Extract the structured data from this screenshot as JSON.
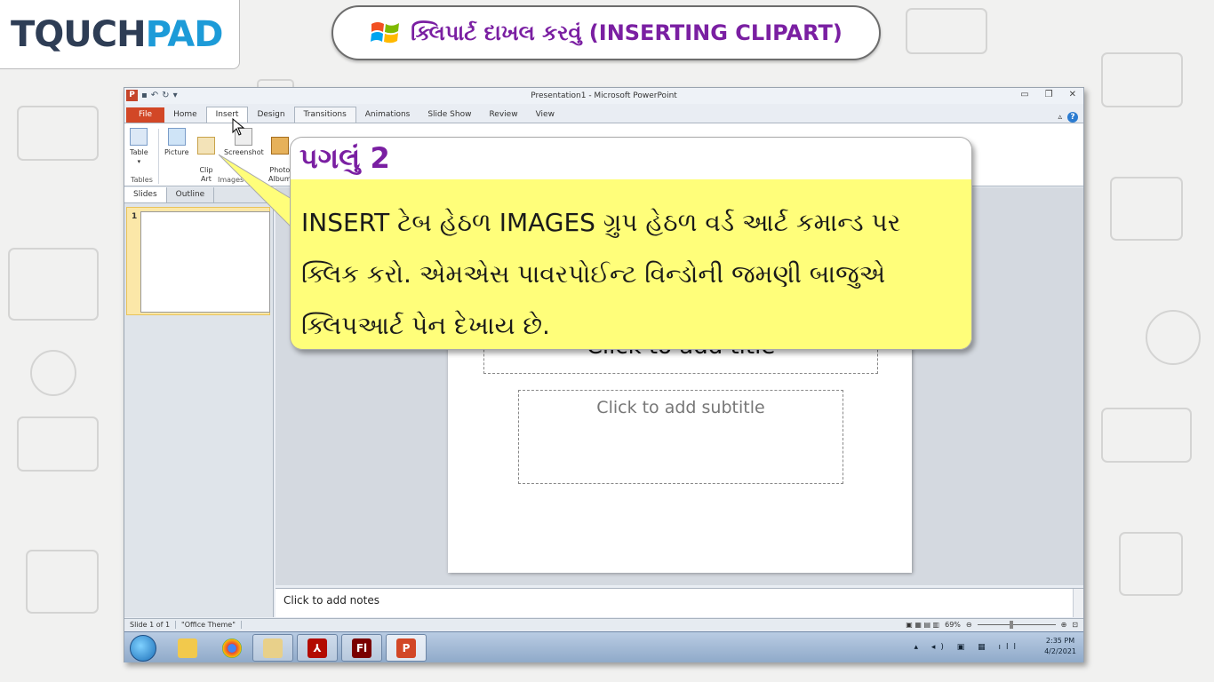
{
  "logo": {
    "part1": "TQUCH",
    "part2": "PAD"
  },
  "header": {
    "title": "ક્લિપાર્ટ દાખલ કરવું (INSERTING CLIPART)"
  },
  "window": {
    "app_title": "Presentation1 - Microsoft PowerPoint",
    "tabs": [
      "File",
      "Home",
      "Insert",
      "Design",
      "Transitions",
      "Animations",
      "Slide Show",
      "Review",
      "View"
    ],
    "active_tab": "Insert"
  },
  "ribbon": {
    "table_label": "Table",
    "picture_label": "Picture",
    "clipart_label": "Clip\nArt",
    "screenshot_label": "Screenshot",
    "photo_label": "Photo\nAlbum",
    "group_tables": "Tables",
    "group_images": "Images"
  },
  "pane": {
    "slides_tab": "Slides",
    "outline_tab": "Outline",
    "thumb_number": "1"
  },
  "slide": {
    "title_placeholder": "Click to add title",
    "subtitle_placeholder": "Click to add subtitle"
  },
  "notes": {
    "placeholder": "Click to add notes"
  },
  "status": {
    "slide_info": "Slide 1 of 1",
    "theme": "\"Office Theme\"",
    "zoom": "69%"
  },
  "taskbar": {
    "time": "2:35 PM",
    "date": "4/2/2021"
  },
  "callout": {
    "step": "પગલું 2",
    "line1": "INSERT ટેબ હેઠળ IMAGES ગ્રુપ હેઠળ વર્ડ આર્ટ કમાન્ડ  પર",
    "line2": "ક્લિક કરો. એમએસ પાવરપોઈન્ટ વિન્ડોની જમણી બાજુએ",
    "line3": "ક્લિપઆર્ટ પેન દેખાય છે."
  },
  "colors": {
    "accent_purple": "#7a1fa2",
    "callout_yellow": "#fffe7a",
    "file_tab": "#d24726",
    "logo_blue": "#1d9bd8"
  }
}
